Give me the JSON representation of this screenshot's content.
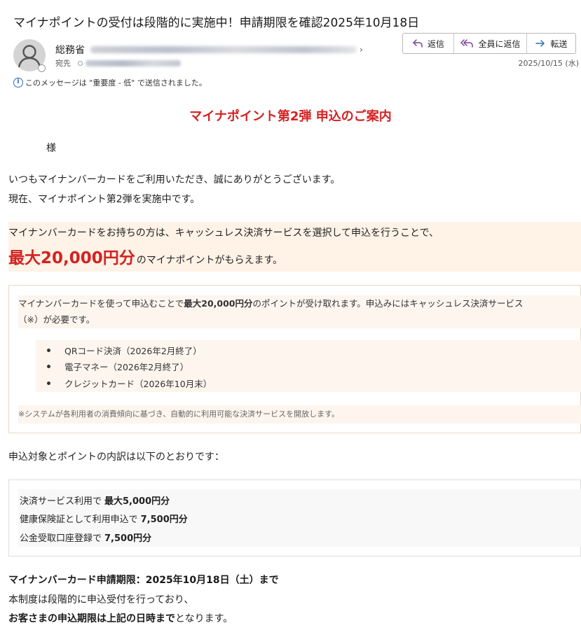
{
  "header": {
    "subject": "マイナポイントの受付は段階的に実施中！申請期限を確認2025年10月18日",
    "sender_name": "総務省",
    "to_label": "宛先",
    "date": "2025/10/15 (水)",
    "importance_notice": "このメッセージは \"重要度 - 低\" で送信されました。",
    "actions": {
      "reply": "返信",
      "reply_all": "全員に返信",
      "forward": "転送"
    }
  },
  "body": {
    "heading": "マイナポイント第2弾 申込のご案内",
    "salutation": "様",
    "intro_line1": "いつもマイナンバーカードをご利用いただき、誠にありがとうございます。",
    "intro_line2": "現在、マイナポイント第2弾を実施中です。",
    "highlight": {
      "line1": "マイナンバーカードをお持ちの方は、キャッシュレス決済サービスを選択して申込を行うことで、",
      "amount": "最大20,000円分",
      "line2_rest": "のマイナポイントがもらえます。"
    },
    "info_box": {
      "text_pre": "マイナンバーカードを使って申込むことで",
      "text_bold": "最大20,000円分",
      "text_post": "のポイントが受け取れます。申込みにはキャッシュレス決済サービス",
      "text_line2": "（※）が必要です。",
      "services": [
        "QRコード決済（2026年2月終了）",
        "電子マネー（2026年2月終了）",
        "クレジットカード（2026年10月末）"
      ],
      "note": "※システムが各利用者の消費傾向に基づき、自動的に利用可能な決済サービスを開放します。"
    },
    "breakdown_intro": "申込対象とポイントの内訳は以下のとおりです：",
    "breakdown": [
      {
        "label": "決済サービス利用で",
        "value": "最大5,000円分"
      },
      {
        "label": "健康保険証として利用申込で",
        "value": "7,500円分"
      },
      {
        "label": "公金受取口座登録で",
        "value": "7,500円分"
      }
    ],
    "deadline": "マイナンバーカード申請期限：2025年10月18日（土）まで",
    "closing_line1": "本制度は段階的に申込受付を行っており、",
    "closing_bold": "お客さまの申込期限は上記の日時まで",
    "closing_rest": "となります。"
  },
  "colors": {
    "accent_red": "#d32222",
    "highlight_bg": "#fff2e6",
    "info_blue": "#2b6fb6"
  }
}
